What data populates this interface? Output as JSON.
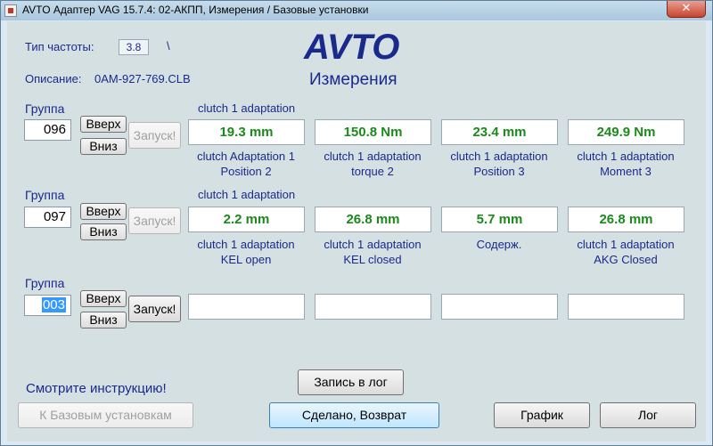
{
  "window": {
    "title": "AVTO Адаптер VAG 15.7.4: 02-АКПП,  Измерения / Базовые установки",
    "close_glyph": "✕"
  },
  "freq": {
    "label": "Тип частоты:",
    "value": "3.8",
    "slash": "\\"
  },
  "description": {
    "label": "Описание:",
    "value": "0AM-927-769.CLB"
  },
  "brand": {
    "logo": "AVTO",
    "subtitle": "Измерения"
  },
  "groups": [
    {
      "label": "Группа",
      "number": "096",
      "up_label": "Вверх",
      "down_label": "Вниз",
      "start_label": "Запуск!",
      "start_enabled": false,
      "header": "clutch 1 adaptation",
      "values": [
        "19.3 mm",
        "150.8 Nm",
        "23.4 mm",
        "249.9 Nm"
      ],
      "captions": [
        [
          "clutch Adaptation 1",
          "Position 2"
        ],
        [
          "clutch 1 adaptation",
          "torque 2"
        ],
        [
          "clutch 1 adaptation",
          "Position 3"
        ],
        [
          "clutch 1 adaptation",
          "Moment 3"
        ]
      ]
    },
    {
      "label": "Группа",
      "number": "097",
      "up_label": "Вверх",
      "down_label": "Вниз",
      "start_label": "Запуск!",
      "start_enabled": false,
      "header": "clutch 1 adaptation",
      "values": [
        "2.2 mm",
        "26.8 mm",
        "5.7 mm",
        "26.8 mm"
      ],
      "captions": [
        [
          "clutch 1 adaptation",
          "KEL open"
        ],
        [
          "clutch 1 adaptation",
          "KEL closed"
        ],
        [
          "Содерж.",
          ""
        ],
        [
          "clutch 1 adaptation",
          "AKG Closed"
        ]
      ]
    },
    {
      "label": "Группа",
      "number": "003",
      "up_label": "Вверх",
      "down_label": "Вниз",
      "start_label": "Запуск!",
      "start_enabled": true,
      "header": "",
      "values": [
        "",
        "",
        "",
        ""
      ],
      "captions": [
        [
          "",
          ""
        ],
        [
          "",
          ""
        ],
        [
          "",
          ""
        ],
        [
          "",
          ""
        ]
      ]
    }
  ],
  "footer": {
    "help_text": "Смотрите инструкцию!",
    "log_record_label": "Запись в лог",
    "basic_settings_label": "К Базовым установкам",
    "done_label": "Сделано, Возврат",
    "graph_label": "График",
    "log_label": "Лог"
  },
  "colors": {
    "value_green": "#1a8a1a",
    "label_navy": "#1a2a8c",
    "background": "#d4e0e2"
  }
}
